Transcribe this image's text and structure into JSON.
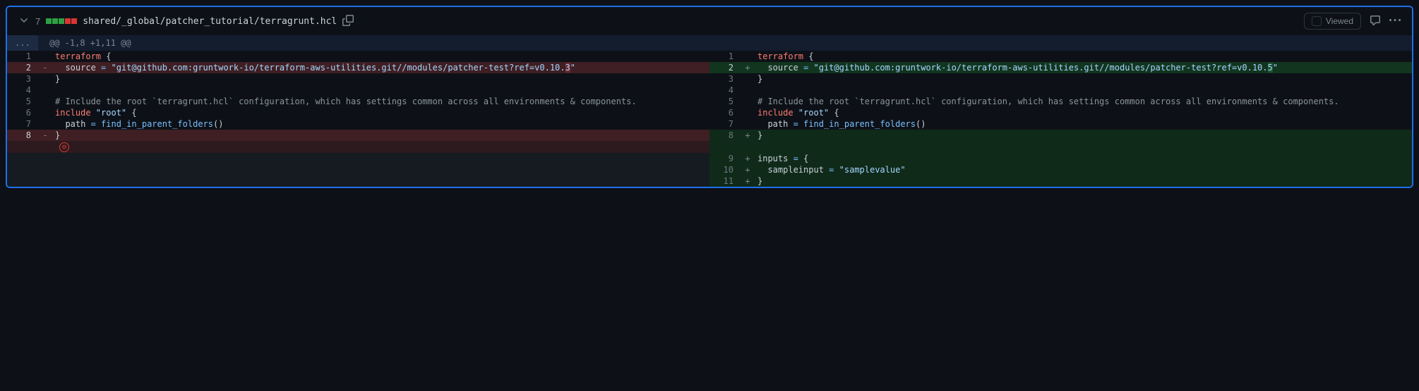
{
  "header": {
    "change_count": "7",
    "diffstat_add": 3,
    "diffstat_del": 2,
    "file_path": "shared/_global/patcher_tutorial/terragrunt.hcl",
    "viewed_label": "Viewed"
  },
  "hunk": {
    "expand_label": "...",
    "info": "@@ -1,8 +1,11 @@"
  },
  "left": [
    {
      "num": "1",
      "marker": "",
      "type": "context",
      "tokens": [
        {
          "t": "terraform ",
          "c": "tok-kw"
        },
        {
          "t": "{",
          "c": ""
        }
      ]
    },
    {
      "num": "2",
      "marker": "-",
      "type": "deletion",
      "tokens": [
        {
          "t": "  source ",
          "c": ""
        },
        {
          "t": "=",
          "c": "tok-op"
        },
        {
          "t": " ",
          "c": ""
        },
        {
          "t": "\"git@github.com:gruntwork-io/terraform-aws-utilities.git//modules/patcher-test?ref=v0.10.",
          "c": "tok-str"
        },
        {
          "t": "3",
          "c": "tok-str tok-hl-del"
        },
        {
          "t": "\"",
          "c": "tok-str"
        }
      ]
    },
    {
      "num": "3",
      "marker": "",
      "type": "context",
      "tokens": [
        {
          "t": "}",
          "c": ""
        }
      ]
    },
    {
      "num": "4",
      "marker": "",
      "type": "context",
      "tokens": []
    },
    {
      "num": "5",
      "marker": "",
      "type": "context",
      "tokens": [
        {
          "t": "# Include the root `terragrunt.hcl` configuration, which has settings common across all environments & components.",
          "c": "tok-cmt"
        }
      ]
    },
    {
      "num": "6",
      "marker": "",
      "type": "context",
      "tokens": [
        {
          "t": "include ",
          "c": "tok-kw"
        },
        {
          "t": "\"root\"",
          "c": "tok-str"
        },
        {
          "t": " {",
          "c": ""
        }
      ]
    },
    {
      "num": "7",
      "marker": "",
      "type": "context",
      "tokens": [
        {
          "t": "  path ",
          "c": ""
        },
        {
          "t": "=",
          "c": "tok-op"
        },
        {
          "t": " ",
          "c": ""
        },
        {
          "t": "find_in_parent_folders",
          "c": "tok-fn"
        },
        {
          "t": "()",
          "c": ""
        }
      ]
    },
    {
      "num": "8",
      "marker": "-",
      "type": "deletion",
      "tokens": [
        {
          "t": "}",
          "c": ""
        }
      ]
    },
    {
      "num": "",
      "marker": "",
      "type": "deletion-soft",
      "no_newline": true,
      "tokens": []
    },
    {
      "num": "",
      "marker": "",
      "type": "empty",
      "tokens": []
    },
    {
      "num": "",
      "marker": "",
      "type": "empty",
      "tokens": []
    },
    {
      "num": "",
      "marker": "",
      "type": "empty",
      "tokens": []
    }
  ],
  "right": [
    {
      "num": "1",
      "marker": "",
      "type": "context",
      "tokens": [
        {
          "t": "terraform ",
          "c": "tok-kw"
        },
        {
          "t": "{",
          "c": ""
        }
      ]
    },
    {
      "num": "2",
      "marker": "+",
      "type": "addition",
      "tokens": [
        {
          "t": "  source ",
          "c": ""
        },
        {
          "t": "=",
          "c": "tok-op"
        },
        {
          "t": " ",
          "c": ""
        },
        {
          "t": "\"git@github.com:gruntwork-io/terraform-aws-utilities.git//modules/patcher-test?ref=v0.10.",
          "c": "tok-str"
        },
        {
          "t": "5",
          "c": "tok-str tok-hl-add"
        },
        {
          "t": "\"",
          "c": "tok-str"
        }
      ]
    },
    {
      "num": "3",
      "marker": "",
      "type": "context",
      "tokens": [
        {
          "t": "}",
          "c": ""
        }
      ]
    },
    {
      "num": "4",
      "marker": "",
      "type": "context",
      "tokens": []
    },
    {
      "num": "5",
      "marker": "",
      "type": "context",
      "tokens": [
        {
          "t": "# Include the root `terragrunt.hcl` configuration, which has settings common across all environments & components.",
          "c": "tok-cmt"
        }
      ]
    },
    {
      "num": "6",
      "marker": "",
      "type": "context",
      "tokens": [
        {
          "t": "include ",
          "c": "tok-kw"
        },
        {
          "t": "\"root\"",
          "c": "tok-str"
        },
        {
          "t": " {",
          "c": ""
        }
      ]
    },
    {
      "num": "7",
      "marker": "",
      "type": "context",
      "tokens": [
        {
          "t": "  path ",
          "c": ""
        },
        {
          "t": "=",
          "c": "tok-op"
        },
        {
          "t": " ",
          "c": ""
        },
        {
          "t": "find_in_parent_folders",
          "c": "tok-fn"
        },
        {
          "t": "()",
          "c": ""
        }
      ]
    },
    {
      "num": "8",
      "marker": "+",
      "type": "addition-soft",
      "tokens": [
        {
          "t": "}",
          "c": ""
        }
      ]
    },
    {
      "num": "",
      "marker": "",
      "type": "addition-soft",
      "tokens": []
    },
    {
      "num": "9",
      "marker": "+",
      "type": "addition-soft",
      "tokens": [
        {
          "t": "inputs ",
          "c": ""
        },
        {
          "t": "=",
          "c": "tok-op"
        },
        {
          "t": " {",
          "c": ""
        }
      ]
    },
    {
      "num": "10",
      "marker": "+",
      "type": "addition-soft",
      "tokens": [
        {
          "t": "  sampleinput ",
          "c": ""
        },
        {
          "t": "=",
          "c": "tok-op"
        },
        {
          "t": " ",
          "c": ""
        },
        {
          "t": "\"samplevalue\"",
          "c": "tok-str"
        }
      ]
    },
    {
      "num": "11",
      "marker": "+",
      "type": "addition-soft",
      "tokens": [
        {
          "t": "}",
          "c": ""
        }
      ]
    }
  ]
}
